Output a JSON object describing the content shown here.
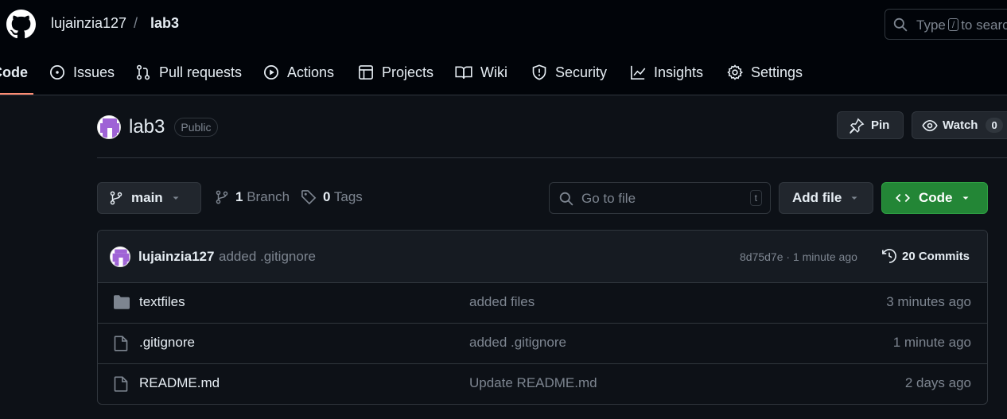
{
  "header": {
    "owner": "lujainzia127",
    "separator": "/",
    "repo": "lab3",
    "search_placeholder": "Type",
    "search_slash": "/",
    "search_suffix": "to search"
  },
  "tabs": [
    {
      "label": "Code",
      "icon": "code-icon",
      "active": true
    },
    {
      "label": "Issues",
      "icon": "issue-icon"
    },
    {
      "label": "Pull requests",
      "icon": "pull-request-icon"
    },
    {
      "label": "Actions",
      "icon": "play-icon"
    },
    {
      "label": "Projects",
      "icon": "table-icon"
    },
    {
      "label": "Wiki",
      "icon": "book-icon"
    },
    {
      "label": "Security",
      "icon": "shield-icon"
    },
    {
      "label": "Insights",
      "icon": "graph-icon"
    },
    {
      "label": "Settings",
      "icon": "gear-icon"
    }
  ],
  "repo_head": {
    "name": "lab3",
    "visibility": "Public",
    "pin_label": "Pin",
    "watch_label": "Watch",
    "watch_count": "0"
  },
  "toolbar": {
    "branch": "main",
    "branch_count": "1",
    "branch_label": "Branch",
    "tag_count": "0",
    "tag_label": "Tags",
    "go_to_file": "Go to file",
    "go_to_file_key": "t",
    "add_file": "Add file",
    "code": "Code"
  },
  "latest_commit": {
    "author": "lujainzia127",
    "message": "added .gitignore",
    "meta": "8d75d7e · 1 minute ago",
    "commits_label": "20 Commits"
  },
  "files": [
    {
      "name": "textfiles",
      "type": "folder",
      "message": "added files",
      "age": "3 minutes ago"
    },
    {
      "name": ".gitignore",
      "type": "file",
      "message": "added .gitignore",
      "age": "1 minute ago"
    },
    {
      "name": "README.md",
      "type": "file",
      "message": "Update README.md",
      "age": "2 days ago"
    }
  ],
  "colors": {
    "accent_underline": "#fd8c73",
    "primary_button": "#238636",
    "background": "#0d1117"
  }
}
